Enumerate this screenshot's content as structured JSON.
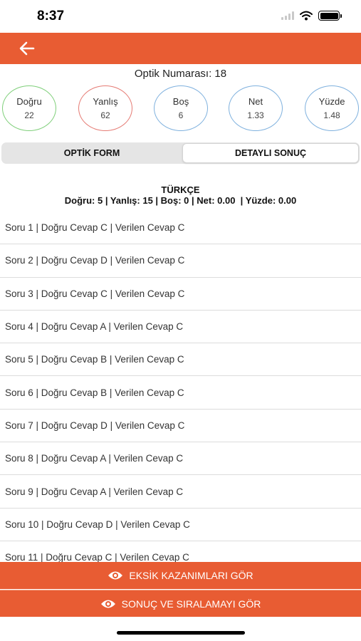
{
  "status_bar": {
    "time": "8:37"
  },
  "header": {
    "back_icon": "arrow-left-icon",
    "color": "#e85c33"
  },
  "optik": {
    "label": "Optik Numarası: 18"
  },
  "stats": [
    {
      "label": "Doğru",
      "value": "22",
      "color": "#7fcf7a"
    },
    {
      "label": "Yanlış",
      "value": "62",
      "color": "#e57b74"
    },
    {
      "label": "Boş",
      "value": "6",
      "color": "#7fb1de"
    },
    {
      "label": "Net",
      "value": "1.33",
      "color": "#7fb1de"
    },
    {
      "label": "Yüzde",
      "value": "1.48",
      "color": "#7fb1de"
    }
  ],
  "tabs": {
    "left": "OPTİK FORM",
    "right": "DETAYLI SONUÇ",
    "active": "right"
  },
  "section": {
    "title": "TÜRKÇE",
    "summary": "Doğru: 5 | Yanlış: 15 | Boş: 0 | Net: 0.00  | Yüzde: 0.00"
  },
  "answers": [
    "Soru 1 | Doğru Cevap C | Verilen Cevap C",
    "Soru 2 | Doğru Cevap D | Verilen Cevap C",
    "Soru 3 | Doğru Cevap C | Verilen Cevap C",
    "Soru 4 | Doğru Cevap A | Verilen Cevap C",
    "Soru 5 | Doğru Cevap B | Verilen Cevap C",
    "Soru 6 | Doğru Cevap B | Verilen Cevap C",
    "Soru 7 | Doğru Cevap D | Verilen Cevap C",
    "Soru 8 | Doğru Cevap A | Verilen Cevap C",
    "Soru 9 | Doğru Cevap A | Verilen Cevap C",
    "Soru 10 | Doğru Cevap D | Verilen Cevap C",
    "Soru 11 | Doğru Cevap C | Verilen Cevap C"
  ],
  "buttons": {
    "missing": "EKSİK KAZANIMLARI GÖR",
    "results": "SONUÇ VE SIRALAMAYI GÖR",
    "icon": "eye-icon"
  }
}
